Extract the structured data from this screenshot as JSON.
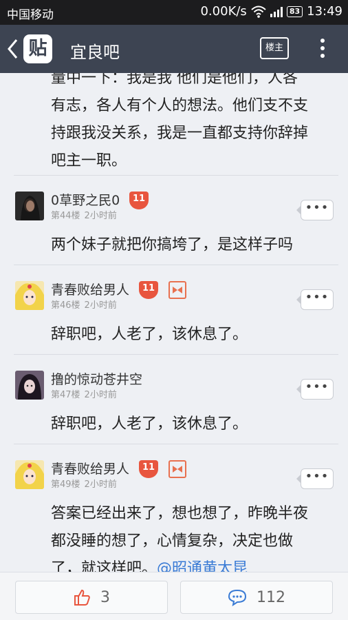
{
  "status_bar": {
    "carrier": "中国移动",
    "speed": "0.00K/s",
    "battery": "83",
    "time": "13:49"
  },
  "header": {
    "logo_text": "贴",
    "title": "宜良吧",
    "owner_button": "楼主",
    "bg_color": "#3d4452"
  },
  "partial_post": {
    "lines": [
      "量中一下：我是我 他们是他们，人各",
      "有志，各人有个人的想法。他们支不支",
      "持跟我没关系，我是一直都支持你辞掉",
      "吧主一职。"
    ]
  },
  "posts": [
    {
      "name": "0草野之民0",
      "level": "11",
      "floor": "第44楼",
      "time": "2小时前",
      "has_badge": false,
      "text": [
        "两个妹子就把你搞垮了，是这样子吗"
      ],
      "avatar_icon": "avatar-dark-hair"
    },
    {
      "name": "青春败给男人",
      "level": "11",
      "floor": "第46楼",
      "time": "2小时前",
      "has_badge": true,
      "text": [
        "辞职吧，人老了，该休息了。"
      ],
      "avatar_icon": "avatar-sailor-moon"
    },
    {
      "name": "撸的惊动苍井空",
      "level": "",
      "floor": "第47楼",
      "time": "2小时前",
      "has_badge": false,
      "text": [
        "辞职吧，人老了，该休息了。"
      ],
      "avatar_icon": "avatar-girl"
    },
    {
      "name": "青春败给男人",
      "level": "11",
      "floor": "第49楼",
      "time": "2小时前",
      "has_badge": true,
      "text": [
        "答案已经出来了，想也想了，昨晚半夜",
        "都没睡的想了，心情复杂，决定也做"
      ],
      "last_line": "了，就这样吧。",
      "mention": "@昭通黄太昆",
      "avatar_icon": "avatar-sailor-moon"
    }
  ],
  "more_label": "•••",
  "bottom_bar": {
    "like_count": "3",
    "comment_count": "112",
    "accent_color": "#e8553e",
    "comment_color": "#3a7bd5"
  }
}
